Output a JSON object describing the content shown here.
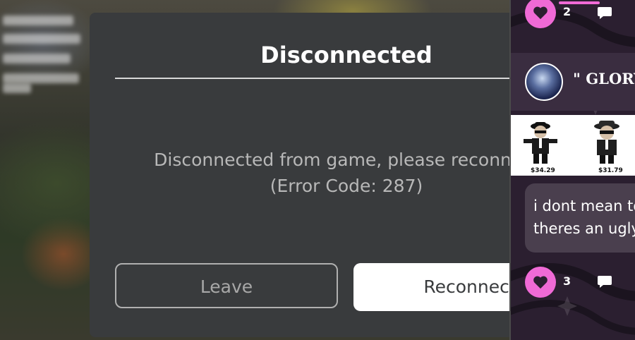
{
  "dialog": {
    "title": "Disconnected",
    "message_line1": "Disconnected from game, please reconnect",
    "message_line2": "(Error Code: 287)",
    "leave_label": "Leave",
    "reconnect_label": "Reconnect"
  },
  "side_panel": {
    "top_like_count": "2",
    "post_username": "\" GLORY",
    "products": [
      {
        "price": "$34.29"
      },
      {
        "price": "$31.79"
      }
    ],
    "message_lines": [
      "i dont mean to",
      "theres an ugly"
    ],
    "bottom_like_count": "3"
  },
  "colors": {
    "dialog_bg": "#393b3d",
    "accent_pink": "#f06ad6",
    "reconnect_bg": "#ffffff"
  },
  "icons": [
    "heart-icon",
    "comment-icon"
  ]
}
